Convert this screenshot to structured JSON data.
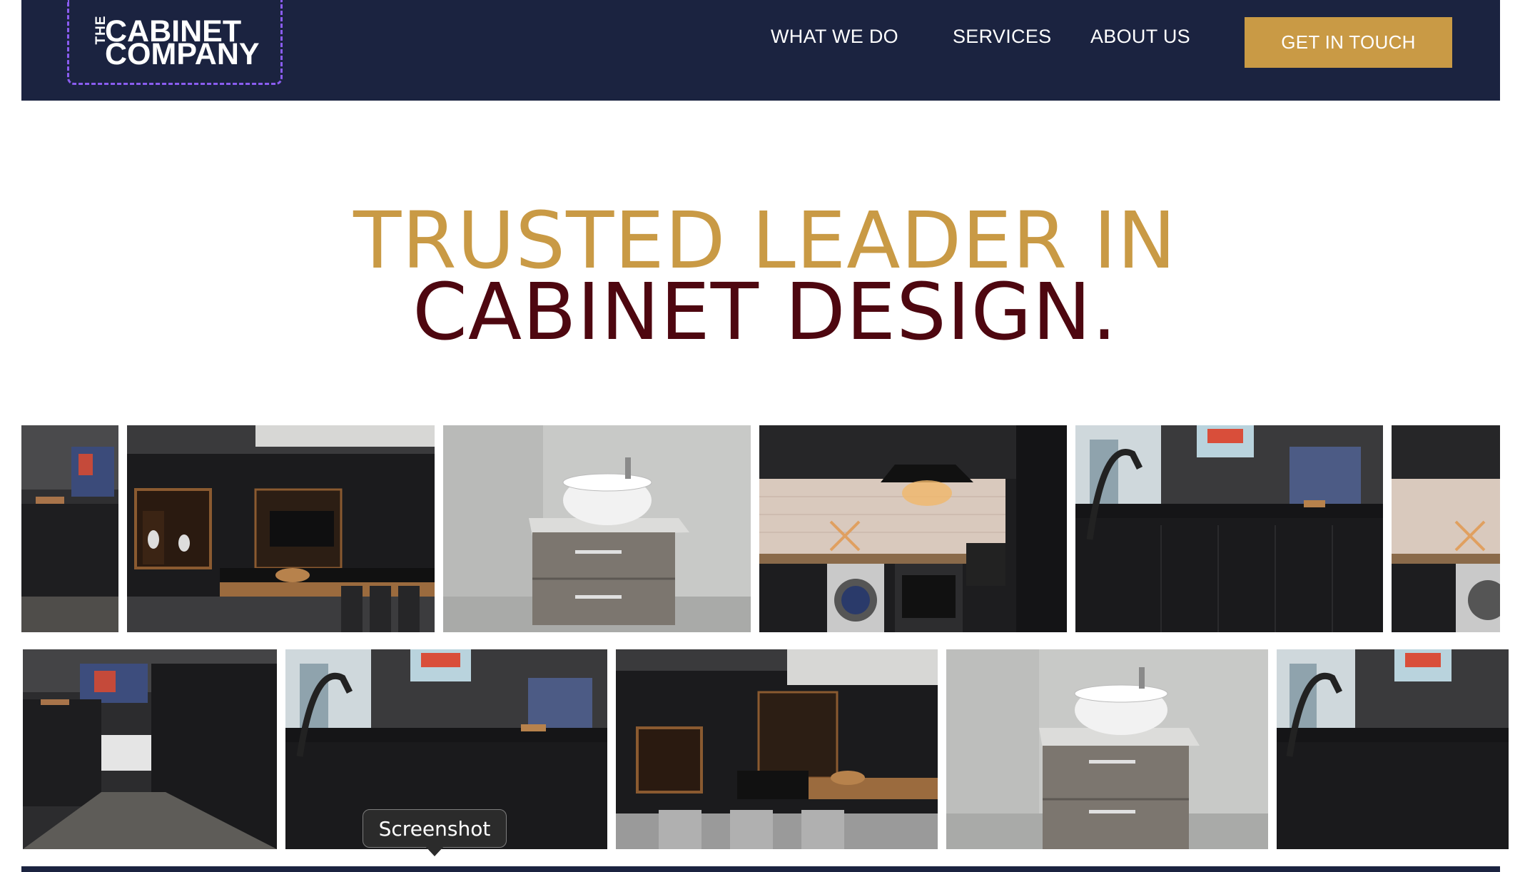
{
  "header": {
    "logo": {
      "the": "THE",
      "line1": "CABINET",
      "line2": "COMPANY"
    },
    "nav": [
      "WHAT WE DO",
      "SERVICES",
      "ABOUT US"
    ],
    "cta_label": "GET IN TOUCH"
  },
  "hero": {
    "line1": "TRUSTED LEADER IN",
    "line2": "CABINET DESIGN."
  },
  "gallery": {
    "row1": [
      "kitchen-image",
      "kitchen-island-image",
      "vanity-basin-image",
      "kitchen-appliances-image",
      "kitchen-window-image",
      "kitchen-appliances-image"
    ],
    "row2": [
      "kitchen-corridor-image",
      "kitchen-window-image",
      "kitchen-island-image",
      "vanity-basin-image",
      "kitchen-window-image"
    ]
  },
  "tooltip": {
    "label": "Screenshot"
  },
  "colors": {
    "header_bg": "#1b2340",
    "accent_gold": "#c99a45",
    "headline_maroon": "#4e0710",
    "logo_outline": "#8a5cf0"
  }
}
